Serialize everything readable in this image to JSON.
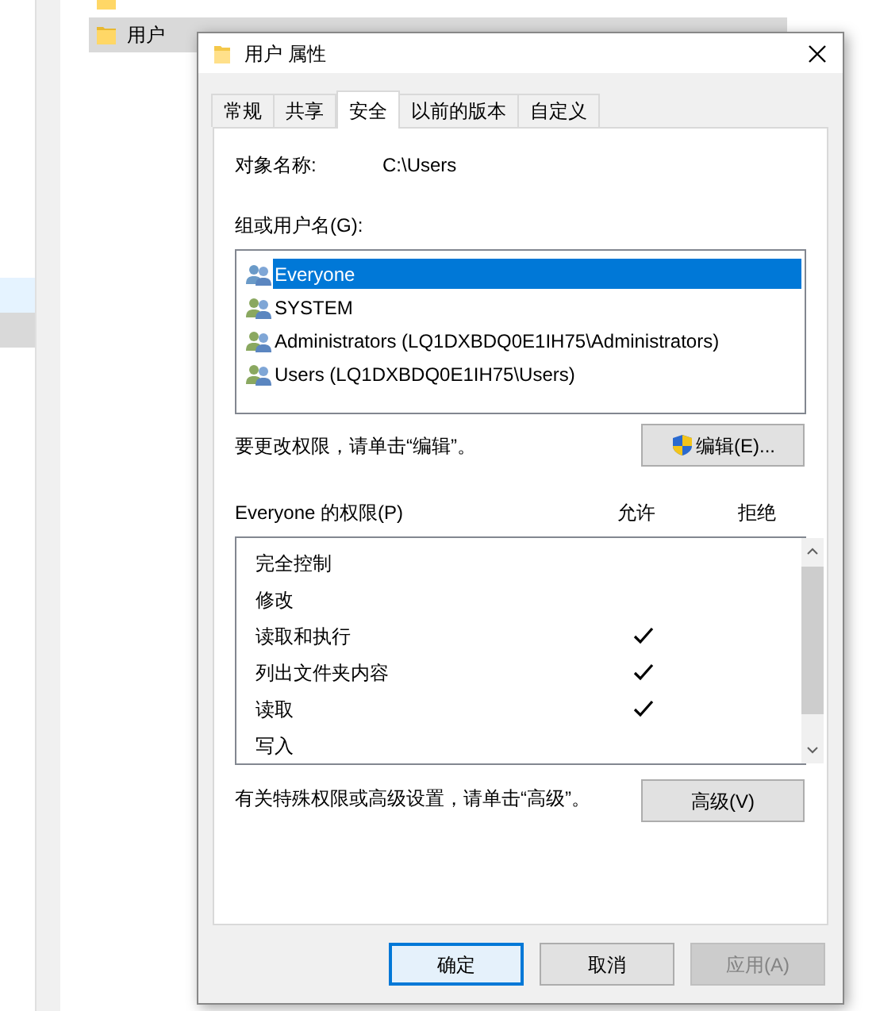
{
  "explorer": {
    "files": [
      {
        "selected": false
      },
      {
        "name": "用户",
        "selected": true
      }
    ]
  },
  "dialog": {
    "title": "用户 属性",
    "tabs": [
      {
        "label": "常规",
        "selected": false
      },
      {
        "label": "共享",
        "selected": false
      },
      {
        "label": "安全",
        "selected": true
      },
      {
        "label": "以前的版本",
        "selected": false
      },
      {
        "label": "自定义",
        "selected": false
      }
    ],
    "object_label": "对象名称:",
    "object_value": "C:\\Users",
    "groups_label": "组或用户名(G):",
    "principals": [
      {
        "name": "Everyone",
        "selected": true
      },
      {
        "name": "SYSTEM",
        "selected": false
      },
      {
        "name": "Administrators (LQ1DXBDQ0E1IH75\\Administrators)",
        "selected": false
      },
      {
        "name": "Users (LQ1DXBDQ0E1IH75\\Users)",
        "selected": false
      }
    ],
    "edit_hint": "要更改权限，请单击“编辑”。",
    "edit_button": "编辑(E)...",
    "permissions_label": "Everyone 的权限(P)",
    "allow_header": "允许",
    "deny_header": "拒绝",
    "permissions": [
      {
        "name": "完全控制",
        "allow": false,
        "deny": false
      },
      {
        "name": "修改",
        "allow": false,
        "deny": false
      },
      {
        "name": "读取和执行",
        "allow": true,
        "deny": false
      },
      {
        "name": "列出文件夹内容",
        "allow": true,
        "deny": false
      },
      {
        "name": "读取",
        "allow": true,
        "deny": false
      },
      {
        "name": "写入",
        "allow": false,
        "deny": false
      }
    ],
    "advanced_hint": "有关特殊权限或高级设置，请单击“高级”。",
    "advanced_button": "高级(V)",
    "buttons": [
      {
        "label": "确定",
        "kind": "default"
      },
      {
        "label": "取消",
        "kind": "normal"
      },
      {
        "label": "应用(A)",
        "kind": "disabled"
      }
    ]
  }
}
